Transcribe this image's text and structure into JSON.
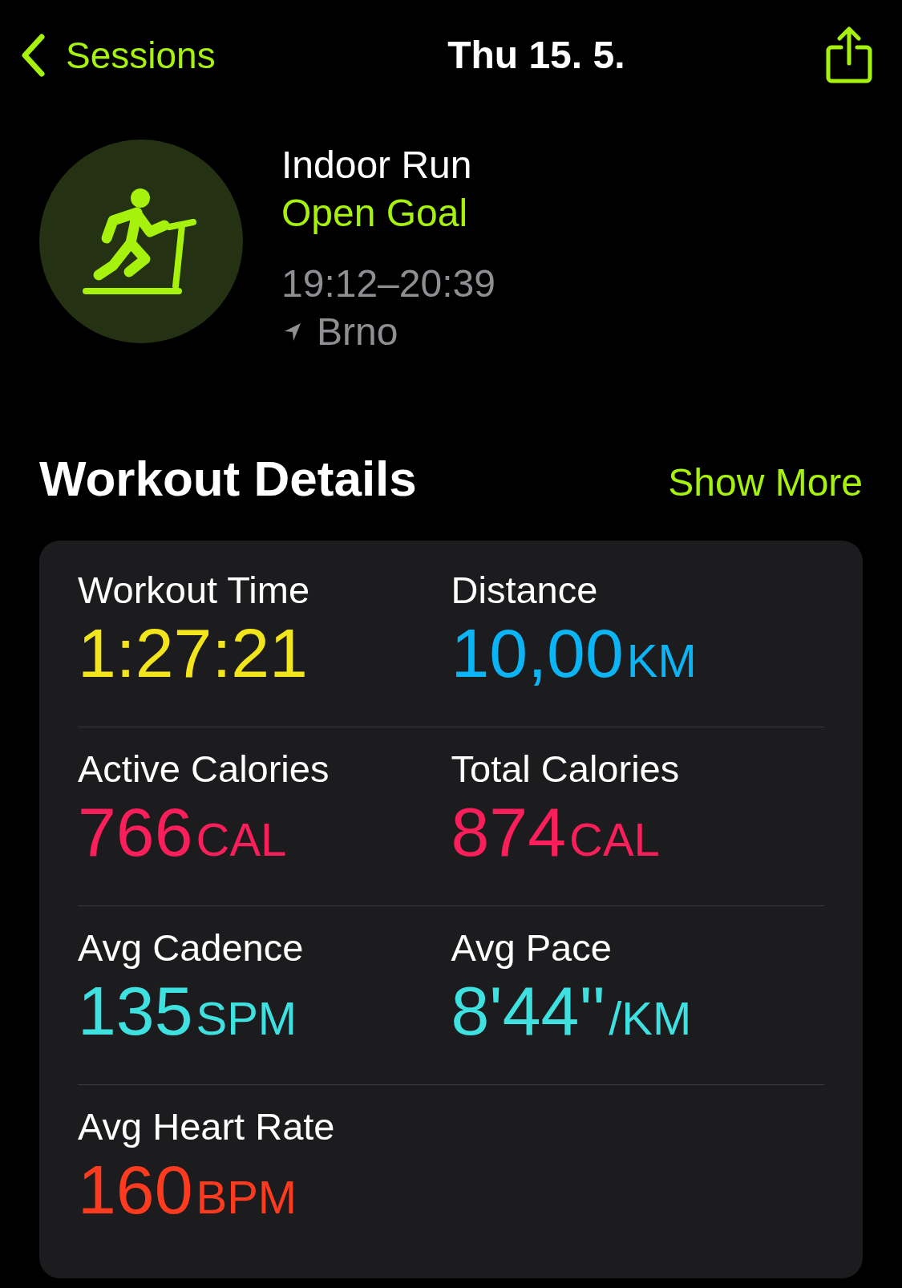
{
  "nav": {
    "back": "Sessions",
    "title": "Thu 15. 5."
  },
  "workout": {
    "name": "Indoor Run",
    "goal": "Open Goal",
    "time": "19:12–20:39",
    "location": "Brno"
  },
  "section": {
    "title": "Workout Details",
    "action": "Show More"
  },
  "metrics": [
    {
      "label": "Workout Time",
      "value": "1:27:21",
      "color": "#f2e51c"
    },
    {
      "label": "Distance",
      "value": "10,00",
      "unit": "KM",
      "color": "#0bb5f5"
    },
    {
      "label": "Active Calories",
      "value": "766",
      "unit": "CAL",
      "color": "#fa1e5a"
    },
    {
      "label": "Total Calories",
      "value": "874",
      "unit": "CAL",
      "color": "#fa1e5a"
    },
    {
      "label": "Avg Cadence",
      "value": "135",
      "unit": "SPM",
      "color": "#3ee0e0"
    },
    {
      "label": "Avg Pace",
      "value": "8'44''",
      "unit": "/KM",
      "color": "#3ee0e0"
    },
    {
      "label": "Avg Heart Rate",
      "value": "160",
      "unit": "BPM",
      "color": "#ff3b1f"
    }
  ]
}
